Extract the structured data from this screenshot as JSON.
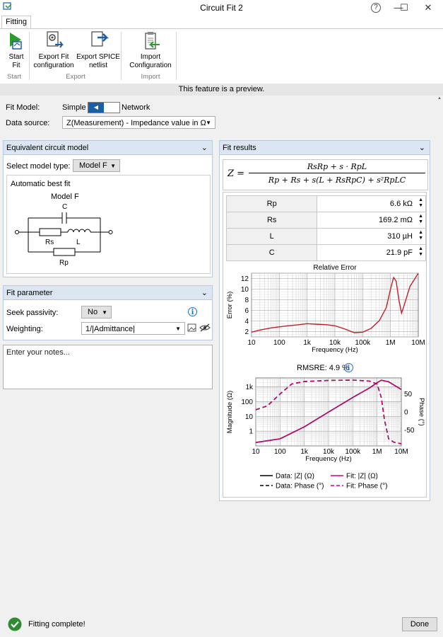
{
  "window": {
    "title": "Circuit Fit 2",
    "help": "?",
    "minimize": "—",
    "maximize": "☐",
    "close": "✕"
  },
  "tabs": [
    {
      "label": "Fitting"
    }
  ],
  "ribbon": {
    "start_fit": "Start\nFit",
    "export_fit": "Export Fit\nconfiguration",
    "export_spice": "Export SPICE\nnetlist",
    "import_config": "Import\nConfiguration",
    "group_start": "Start",
    "group_export": "Export",
    "group_import": "Import"
  },
  "preview_banner": "This feature is a preview.",
  "fit_model": {
    "label": "Fit Model:",
    "simple": "Simple",
    "network": "Network",
    "selected": "Simple"
  },
  "data_source": {
    "label": "Data source:",
    "value": "Z(Measurement) - Impedance value in Ω"
  },
  "equivalent_circuit": {
    "header": "Equivalent circuit model",
    "select_label": "Select model type:",
    "model_value": "Model F",
    "auto_best_fit": "Automatic best fit",
    "model_name": "Model F",
    "labels": {
      "c": "C",
      "rs": "Rs",
      "l": "L",
      "rp": "Rp"
    }
  },
  "fit_parameter": {
    "header": "Fit parameter",
    "seek_label": "Seek passivity:",
    "seek_value": "No",
    "weighting_label": "Weighting:",
    "weighting_value": "1/|Admittance|"
  },
  "notes": {
    "placeholder": "Enter your notes..."
  },
  "fit_results": {
    "header": "Fit results",
    "formula": {
      "lhs": "Z =",
      "numerator": "RsRp + s · RpL",
      "denominator": "Rp + Rs + s(L + RsRpC) + s²RpLC"
    },
    "params": [
      {
        "name": "Rp",
        "value": "6.6 kΩ"
      },
      {
        "name": "Rs",
        "value": "169.2 mΩ"
      },
      {
        "name": "L",
        "value": "310 µH"
      },
      {
        "name": "C",
        "value": "21.9 pF"
      }
    ],
    "rmsre": "RMSRE: 4.9 %"
  },
  "chart_data": [
    {
      "type": "line",
      "title": "Relative Error",
      "xlabel": "Frequency (Hz)",
      "ylabel": "Error (%)",
      "xscale": "log",
      "xlim": [
        10,
        10000000
      ],
      "ylim": [
        1,
        13
      ],
      "xticks": [
        "10",
        "100",
        "1k",
        "10k",
        "100k",
        "1M",
        "10M"
      ],
      "yticks": [
        "2",
        "4",
        "6",
        "8",
        "10",
        "12"
      ],
      "grid": true,
      "series": [
        {
          "color": "#c0202a",
          "x": [
            10,
            20,
            50,
            100,
            200,
            500,
            1000,
            2000,
            5000,
            10000,
            20000,
            50000,
            100000,
            200000,
            400000,
            700000,
            1000000,
            1300000,
            1600000,
            2000000,
            2500000,
            3000000,
            5000000,
            10000000
          ],
          "y": [
            1.9,
            2.3,
            2.7,
            2.9,
            3.1,
            3.3,
            3.5,
            3.4,
            3.3,
            3.1,
            2.6,
            1.8,
            1.9,
            2.6,
            4.1,
            6.5,
            10.0,
            12.2,
            11.5,
            8.0,
            5.5,
            6.7,
            10.5,
            13.0
          ]
        }
      ]
    },
    {
      "type": "line",
      "title": "",
      "xlabel": "Frequency (Hz)",
      "ylabel": "Magnitude (Ω)",
      "y2label": "Phase (°)",
      "xscale": "log",
      "xlim": [
        10,
        10000000
      ],
      "xticks": [
        "10",
        "100",
        "1k",
        "10k",
        "100k",
        "1M",
        "10M"
      ],
      "yscale": "log",
      "yticks": [
        "1",
        "10",
        "100",
        "1k"
      ],
      "y2ticks": [
        "50",
        "0",
        "-50"
      ],
      "grid": true,
      "legend_position": "bottom",
      "series": [
        {
          "name": "Data: |Z| (Ω)",
          "color": "#000000",
          "dash": "solid",
          "x": [
            10,
            100,
            1000,
            10000,
            100000,
            500000,
            1000000,
            1500000,
            3000000,
            10000000
          ],
          "y": [
            0.169,
            0.3,
            1.95,
            19.5,
            190,
            860,
            1900,
            2800,
            2200,
            660
          ]
        },
        {
          "name": "Fit: |Z| (Ω)",
          "color": "#d0007f",
          "dash": "solid",
          "x": [
            10,
            100,
            1000,
            10000,
            100000,
            500000,
            1000000,
            1500000,
            3000000,
            10000000
          ],
          "y": [
            0.169,
            0.3,
            1.95,
            19.5,
            190,
            860,
            1900,
            2800,
            2200,
            660
          ]
        },
        {
          "name": "Data: Phase (°)",
          "color": "#000000",
          "dash": "dash",
          "x": [
            10,
            30,
            100,
            300,
            1000,
            10000,
            100000,
            500000,
            1000000,
            1500000,
            2000000,
            3000000,
            5000000,
            10000000
          ],
          "y": [
            6,
            17,
            50,
            78,
            85,
            88,
            89,
            86,
            78,
            40,
            -20,
            -75,
            -85,
            -89
          ]
        },
        {
          "name": "Fit: Phase (°)",
          "color": "#d0007f",
          "dash": "dash",
          "x": [
            10,
            30,
            100,
            300,
            1000,
            10000,
            100000,
            500000,
            1000000,
            1500000,
            2000000,
            3000000,
            5000000,
            10000000
          ],
          "y": [
            6,
            17,
            50,
            78,
            85,
            88,
            89,
            86,
            78,
            40,
            -20,
            -75,
            -85,
            -89
          ]
        }
      ]
    }
  ],
  "status": {
    "text": "Fitting complete!",
    "done": "Done"
  }
}
